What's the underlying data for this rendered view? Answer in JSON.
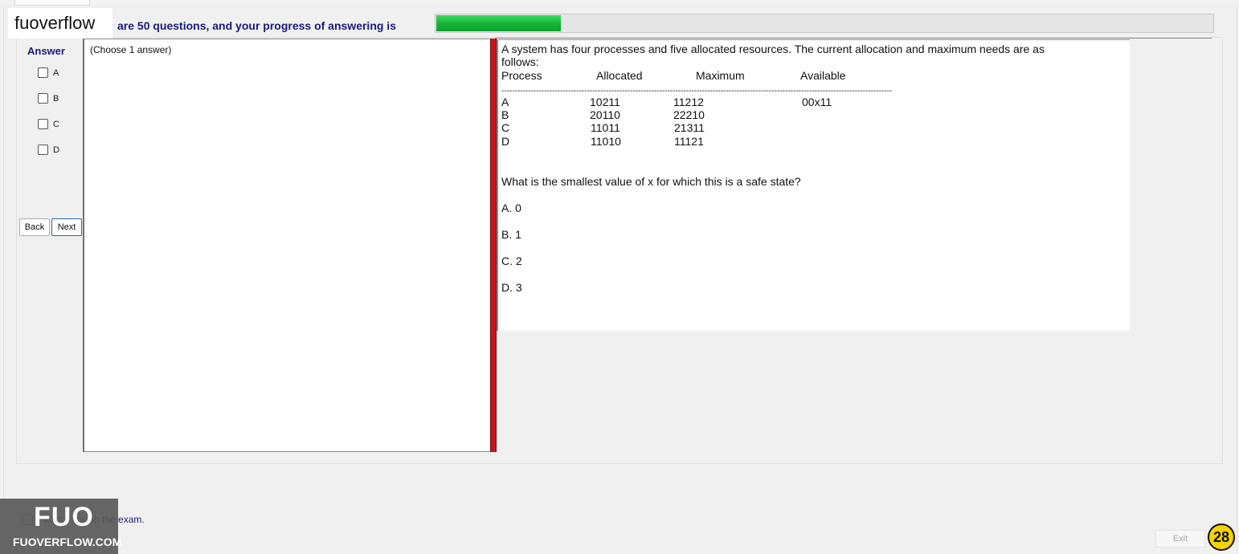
{
  "brand": {
    "name": "fuoverflow"
  },
  "progress": {
    "label": "are 50 questions, and your progress of answering is",
    "value_fraction": 0.16
  },
  "answer_panel": {
    "heading": "Answer",
    "options": [
      "A",
      "B",
      "C",
      "D"
    ],
    "hint": "(Choose 1 answer)"
  },
  "navigation": {
    "back_label": "Back",
    "next_label": "Next"
  },
  "question": {
    "intro_line1": "A system has four processes and five allocated resources. The current allocation and maximum needs are as",
    "intro_line2": "follows:",
    "headers": [
      "Process",
      "Allocated",
      "Maximum",
      "Available"
    ],
    "separator": "--------------------------------------------------------------------------------------------------------------------------------------------------",
    "rows": [
      {
        "process": "A",
        "allocated": "10211",
        "maximum": "11212",
        "available": "00x11"
      },
      {
        "process": "B",
        "allocated": "20110",
        "maximum": "22210",
        "available": ""
      },
      {
        "process": "C",
        "allocated": "11011",
        "maximum": "21311",
        "available": ""
      },
      {
        "process": "D",
        "allocated": "11010",
        "maximum": "11121",
        "available": ""
      }
    ],
    "prompt": "What is the smallest value of x for which this is a safe state?",
    "choices": [
      "A.  0",
      "B.  1",
      "C.  2",
      "D.  3"
    ]
  },
  "footer": {
    "finish_label": "I want to finish the exam.",
    "finish_visible_text": "ish the exam.",
    "exit_label": "Exit",
    "page_number": "28",
    "logo_mark": "FUO",
    "logo_url": "FUOVERFLOW.COM"
  },
  "colors": {
    "progress_green": "#14b43a",
    "divider_red": "#c8141b",
    "heading_blue": "#1a1a7a",
    "badge_yellow": "#f4d300"
  }
}
